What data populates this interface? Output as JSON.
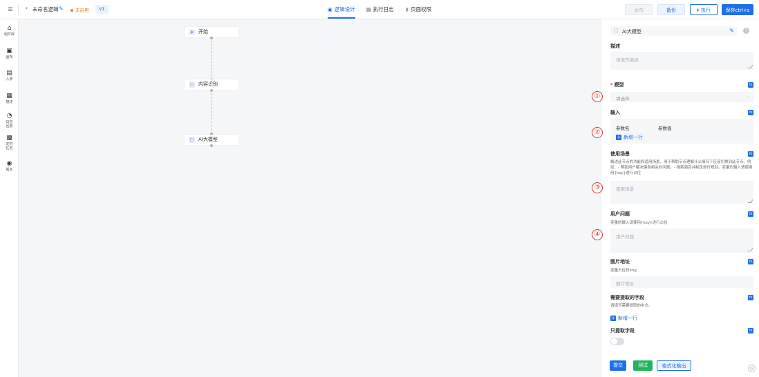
{
  "topbar": {
    "menu_icon": "menu-icon",
    "title": "未命名逻辑",
    "status": "未启用",
    "version": "V1",
    "tabs": [
      {
        "label": "逻辑设计",
        "icon": "logic-design-icon",
        "glyph": "▣"
      },
      {
        "label": "执行日志",
        "icon": "document-icon",
        "glyph": "▤"
      },
      {
        "label": "页面权限",
        "icon": "key-icon",
        "glyph": "⚷"
      }
    ],
    "buttons": {
      "publish": "发布",
      "backup": "备份",
      "run": "执行",
      "save": "保存ctrl+s"
    }
  },
  "sidebar": {
    "items": [
      {
        "label": "组件库",
        "icon": "home-icon",
        "glyph": "⌂"
      },
      {
        "label": "画布",
        "icon": "canvas-icon",
        "glyph": "▣"
      },
      {
        "label": "入参",
        "icon": "input-param-icon",
        "glyph": "▤"
      },
      {
        "label": "描述",
        "icon": "description-icon",
        "glyph": "▦"
      },
      {
        "label": "日志\n回放",
        "icon": "log-replay-icon",
        "glyph": "◔"
      },
      {
        "label": "定时\n任务",
        "icon": "scheduled-task-icon",
        "glyph": "▩"
      },
      {
        "label": "版本",
        "icon": "version-icon",
        "glyph": "◉"
      }
    ]
  },
  "canvas": {
    "nodes": [
      {
        "label": "开始",
        "icon": "start-node-icon"
      },
      {
        "label": "内容识别",
        "icon": "content-recognition-icon"
      },
      {
        "label": "AI大模型",
        "icon": "ai-model-icon"
      }
    ]
  },
  "panel": {
    "header_title": "AI大模型",
    "description": {
      "label": "描述",
      "placeholder": "请填写描述"
    },
    "model": {
      "label": "模型",
      "required_mark": "*",
      "placeholder": "请选择"
    },
    "input": {
      "label": "输入",
      "col_name": "参数名",
      "col_value": "参数值",
      "add_row": "新增一行"
    },
    "scenario": {
      "label": "使用场景",
      "hint": "概述此节点的功能和适用场景，用于帮助节点理解什么情况下应该切换到此节点。例如：- 帮助用户解决健身相关的问题。- 搜索酒店并制定旅行规划。变量的输入请使用用{key}进行占位",
      "placeholder": "使用场景"
    },
    "question": {
      "label": "用户问题",
      "hint": "变量的输入请使用{key}进行占位",
      "placeholder": "用户问题"
    },
    "image": {
      "label": "图片地址",
      "hint": "变量占位符img",
      "placeholder": "图片地址"
    },
    "extract": {
      "label": "需要提取的字段",
      "hint": "请填写需要提取的中文。",
      "add_row": "新增一行"
    },
    "only_extract": {
      "label": "只提取字段",
      "enabled": false
    },
    "footer": {
      "submit": "提交",
      "test": "测试",
      "format": "格式化输出"
    }
  },
  "annotations": [
    "①",
    "②",
    "③",
    "④"
  ],
  "colors": {
    "primary": "#1e6fe8",
    "success": "#21b45b",
    "warning": "#e08a2e",
    "annotation": "#d9392f"
  }
}
